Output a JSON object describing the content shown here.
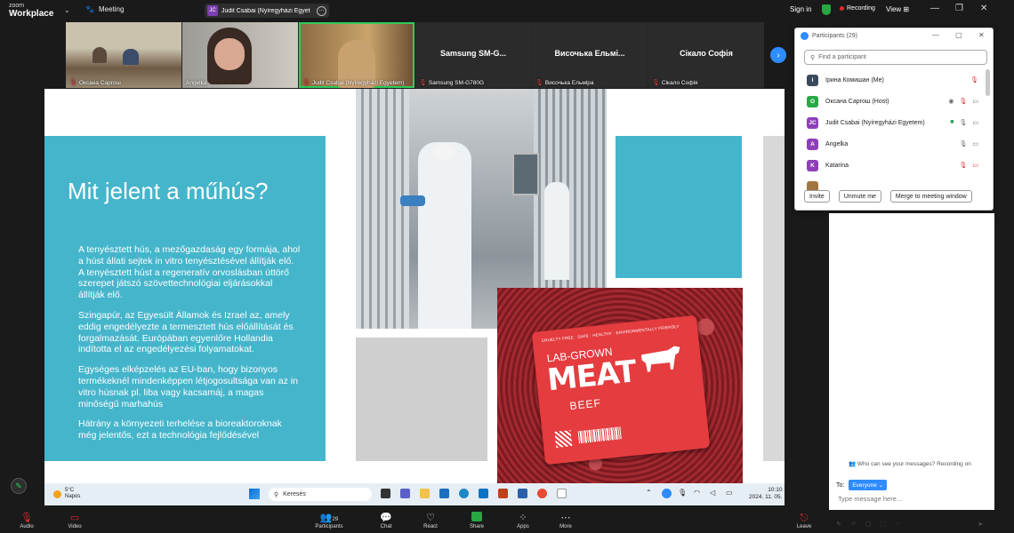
{
  "topbar": {
    "logo_line1": "zoom",
    "logo_line2": "Workplace",
    "meeting_label": "Meeting",
    "share_chip_initials": "JC",
    "share_chip_label": "Judit Csabai (Nyíregyházi Egyetem)",
    "sign_in": "Sign in",
    "recording": "Recording",
    "view": "View"
  },
  "thumbnails": [
    {
      "label": "Оксана Саргош",
      "bigname": "",
      "muted": true
    },
    {
      "label": "Angelka",
      "bigname": "",
      "muted": false
    },
    {
      "label": "Judit Csabai (Nyíregyházi Egyetem)",
      "bigname": "",
      "muted": true
    },
    {
      "label": "Samsung SM-G780G",
      "bigname": "Samsung  SM-G...",
      "muted": true
    },
    {
      "label": "Височька Ельміра",
      "bigname": "Височька  Ельмі...",
      "muted": true
    },
    {
      "label": "Сікало Софія",
      "bigname": "Сікало Софія",
      "muted": true
    }
  ],
  "slide": {
    "title": "Mit jelent a műhús?",
    "paragraphs": [
      "A tenyésztett hús, a mezőgazdaság egy formája, ahol a húst állati sejtek in vitro tenyésztésével állítják elő. A tenyésztett húst a regeneratív orvoslásban úttörő szerepet játszó szövettechnológiai eljárásokkal állítják elő.",
      "Szingapúr, az Egyesült Államok és Izrael az, amely eddig engedélyezte a termesztett hús előállítását és forgalmazását. Európában egyenlőre Hollandia indította el az engedélyezési folyamatokat.",
      "Egységes elképzelés az EU-ban, hogy bizonyos termékeknél mindenképpen létjogosultsága van az in vitro húsnak pl. liba vagy kacsamáj, a magas minőségű marhahús",
      "Hátrány a környezeti terhelése a bioreaktoroknak még jelentős, ezt a technológia fejlődésével"
    ],
    "meat_small": "CRUELTY FREE · SAFE · HEALTHY · ENVIRONMENTALLY FRIENDLY",
    "meat_lab": "LAB-GROWN",
    "meat_big": "MEAT",
    "meat_beef": "BEEF"
  },
  "wintaskbar": {
    "temp": "5°C",
    "weather": "Napos",
    "search": "Keresés",
    "time": "10:10",
    "date": "2024. 11. 05."
  },
  "participants": {
    "title": "Participants (29)",
    "search_placeholder": "Find a participant",
    "list": [
      {
        "initial": "I",
        "name": "Ірина Комишан (Me)",
        "color": "#3a4a5a"
      },
      {
        "initial": "O",
        "name": "Оксана Саргош (Host)",
        "color": "#27a844"
      },
      {
        "initial": "JC",
        "name": "Judit Csabai (Nyíregyházi Egyetem)",
        "color": "#8e3fb8"
      },
      {
        "initial": "A",
        "name": "Angelka",
        "color": "#8e3fb8"
      },
      {
        "initial": "K",
        "name": "Katarina",
        "color": "#8e3fb8"
      },
      {
        "initial": "",
        "name": "",
        "color": "#a0763e"
      }
    ],
    "invite": "Invite",
    "unmute": "Unmute me",
    "merge": "Merge to meeting window"
  },
  "chat": {
    "notice": "Who can see your messages? Recording on",
    "to_label": "To:",
    "everyone": "Everyone",
    "placeholder": "Type message here..."
  },
  "toolbar": {
    "audio": "Audio",
    "video": "Video",
    "participants": "Participants",
    "participant_count": "29",
    "chat": "Chat",
    "react": "React",
    "share": "Share",
    "apps": "Apps",
    "more": "More",
    "leave": "Leave"
  }
}
